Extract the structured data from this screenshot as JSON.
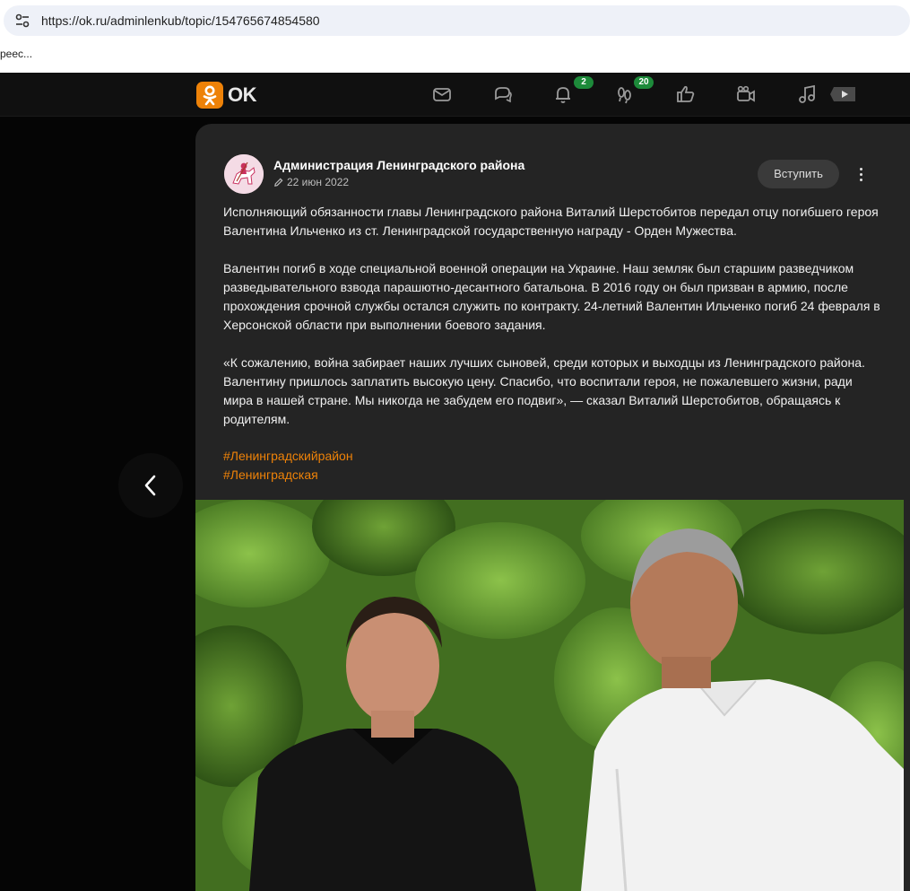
{
  "browser": {
    "url": "https://ok.ru/adminlenkub/topic/154765674854580",
    "bookmark": "реес..."
  },
  "nav": {
    "logo_text": "OK",
    "icons": [
      "messages-icon",
      "discussions-icon",
      "notifications-icon",
      "guests-icon",
      "likes-icon",
      "video-icon",
      "music-icon",
      "video-showcase-icon"
    ],
    "notifications_badge": "2",
    "guests_badge": "20"
  },
  "post": {
    "group_name": "Администрация Ленинградского района",
    "date": "22 июн 2022",
    "join_label": "Вступить",
    "paragraphs": [
      "Исполняющий обязанности главы Ленинградского района Виталий Шерстобитов передал отцу погибшего героя Валентина Ильченко из ст. Ленинградской государственную награду - Орден Мужества.",
      "Валентин погиб в ходе специальной военной операции на Украине. Наш земляк был старшим разведчиком разведывательного взвода парашютно-десантного батальона. В 2016 году он был призван в армию, после прохождения срочной службы остался служить по контракту. 24-летний Валентин Ильченко погиб 24 февраля в Херсонской области при выполнении боевого задания.",
      "«К сожалению, война забирает наших лучших сыновей, среди которых и выходцы из Ленинградского района. Валентину пришлось заплатить высокую цену. Спасибо, что воспитали героя, не пожалевшего жизни, ради мира в нашей стране. Мы никогда не забудем его подвиг», — сказал Виталий Шерстобитов, обращаясь к родителям."
    ],
    "tags": [
      "#Ленинградскийрайон",
      "#Ленинградская"
    ]
  },
  "colors": {
    "accent": "#ee8208",
    "badge": "#1d8a3a",
    "card": "#242424"
  }
}
